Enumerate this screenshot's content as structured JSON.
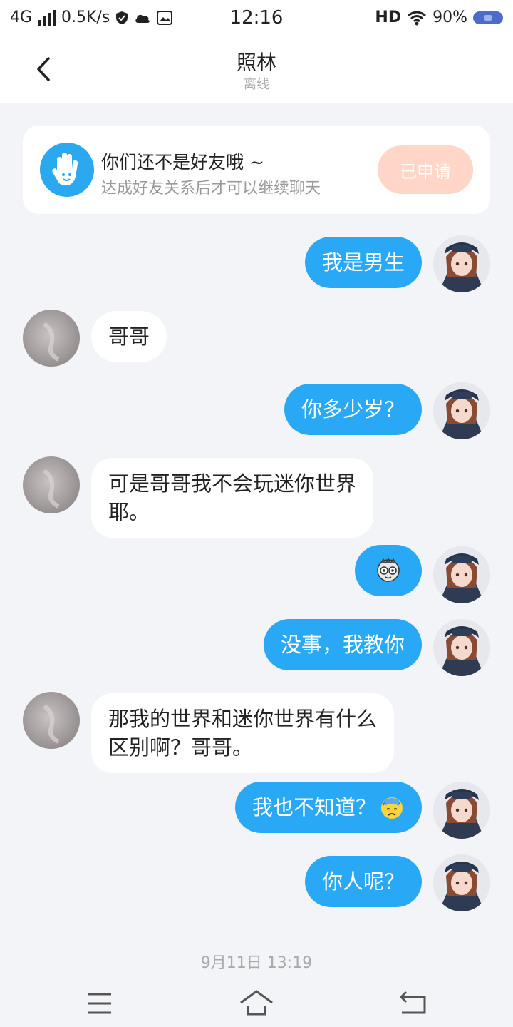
{
  "status_bar": {
    "network": "4G",
    "speed": "0.5K/s",
    "time": "12:16",
    "hd": "HD",
    "battery": "90%"
  },
  "header": {
    "title": "照林",
    "subtitle": "离线"
  },
  "notice": {
    "title": "你们还不是好友哦 ~",
    "subtitle": "达成好友关系后才可以继续聊天",
    "button_label": "已申请",
    "icon": "hand-wave-icon"
  },
  "messages": [
    {
      "from": "me",
      "text": "我是男生"
    },
    {
      "from": "other",
      "text": "哥哥"
    },
    {
      "from": "me",
      "text": "你多少岁？"
    },
    {
      "from": "other",
      "line1": "可是哥哥我不会玩迷你世界",
      "line2": "耶。"
    },
    {
      "from": "me",
      "sticker": "cartoon-face-icon"
    },
    {
      "from": "me",
      "text": "没事，我教你"
    },
    {
      "from": "other",
      "line1": "那我的世界和迷你世界有什么",
      "line2": "区别啊？哥哥。"
    },
    {
      "from": "me",
      "text": "我也不知道？",
      "emoji": "sweat-frown-emoji-icon"
    },
    {
      "from": "me",
      "text": "你人呢？"
    }
  ],
  "timestamp": "9月11日 13:19",
  "colors": {
    "accent": "#29a9f5",
    "background": "#f2f4f7",
    "applied_button": "#ffd6c8"
  },
  "nav": [
    "menu-icon",
    "home-icon",
    "back-arrow-icon"
  ]
}
